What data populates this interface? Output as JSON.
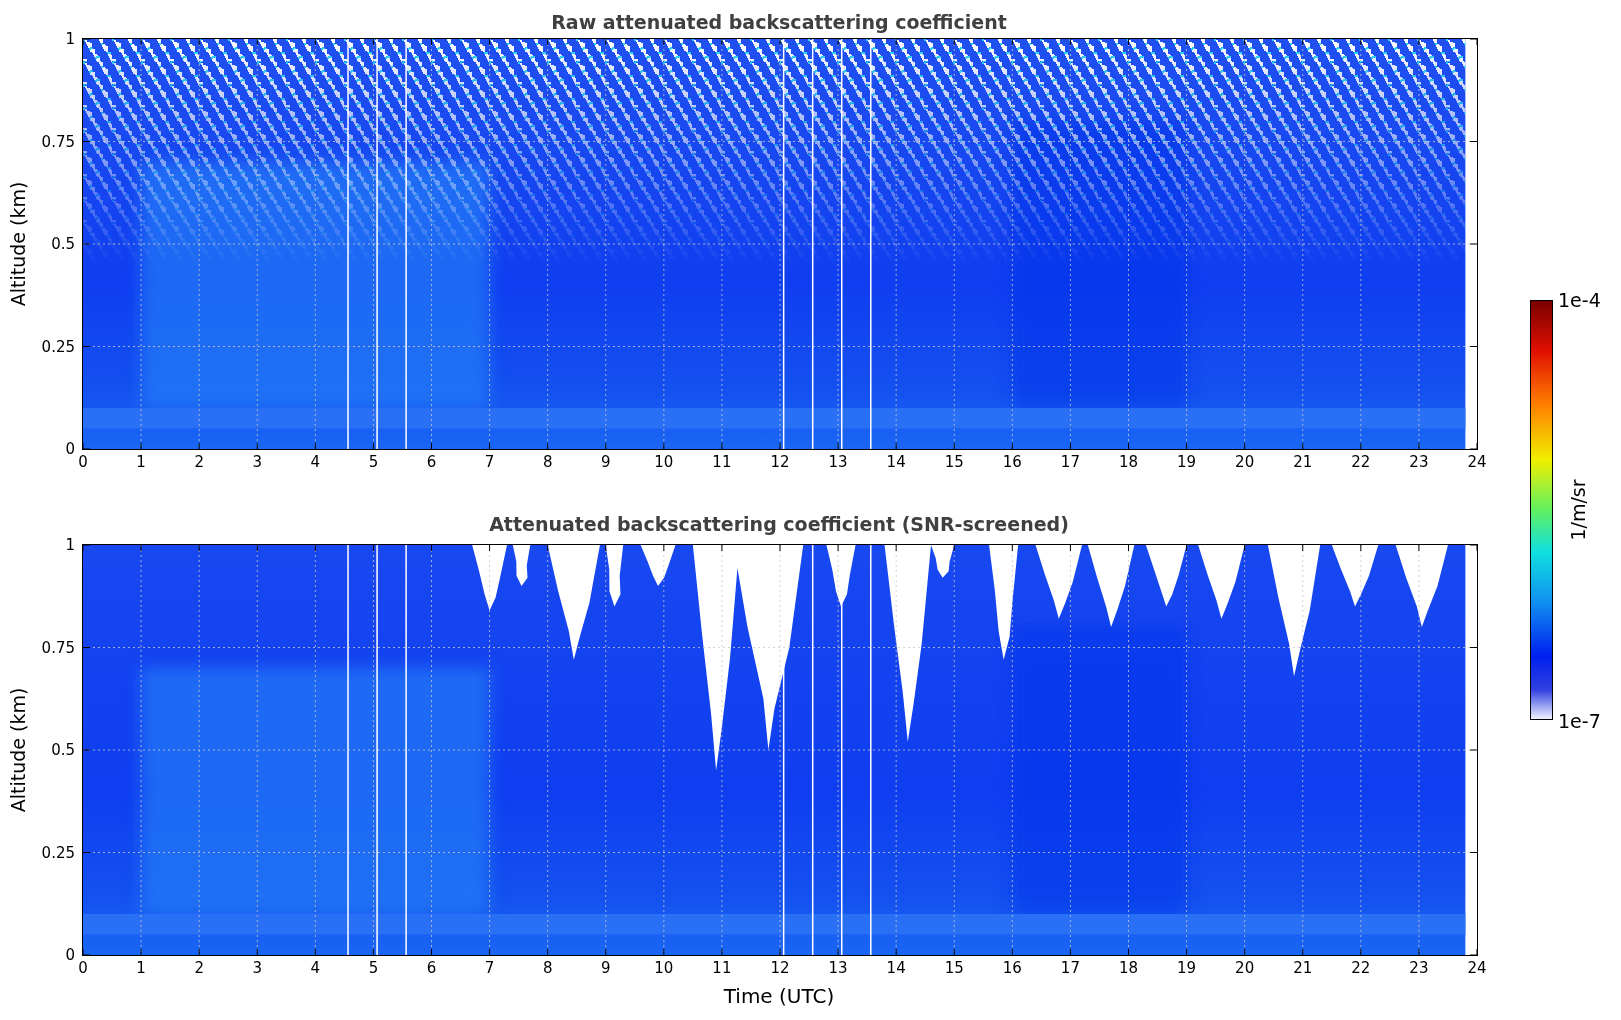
{
  "figure": {
    "panels": [
      {
        "kind": "raw",
        "title": "Raw attenuated backscattering coefficient",
        "ylabel": "Altitude (km)",
        "yticks": [
          "1",
          "0.75",
          "0.5",
          "0.25",
          "0"
        ],
        "xticks": [
          "0",
          "1",
          "2",
          "3",
          "4",
          "5",
          "6",
          "7",
          "8",
          "9",
          "10",
          "11",
          "12",
          "13",
          "14",
          "15",
          "16",
          "17",
          "18",
          "19",
          "20",
          "21",
          "22",
          "23",
          "24"
        ]
      },
      {
        "kind": "screened",
        "title": "Attenuated backscattering coefficient (SNR-screened)",
        "ylabel": "Altitude (km)",
        "yticks": [
          "1",
          "0.75",
          "0.5",
          "0.25",
          "0"
        ],
        "xticks": [
          "0",
          "1",
          "2",
          "3",
          "4",
          "5",
          "6",
          "7",
          "8",
          "9",
          "10",
          "11",
          "12",
          "13",
          "14",
          "15",
          "16",
          "17",
          "18",
          "19",
          "20",
          "21",
          "22",
          "23",
          "24"
        ]
      }
    ],
    "xlabel": "Time (UTC)",
    "colorbar": {
      "max": "1e-4",
      "min": "1e-7",
      "label": "1/m/sr"
    }
  }
}
